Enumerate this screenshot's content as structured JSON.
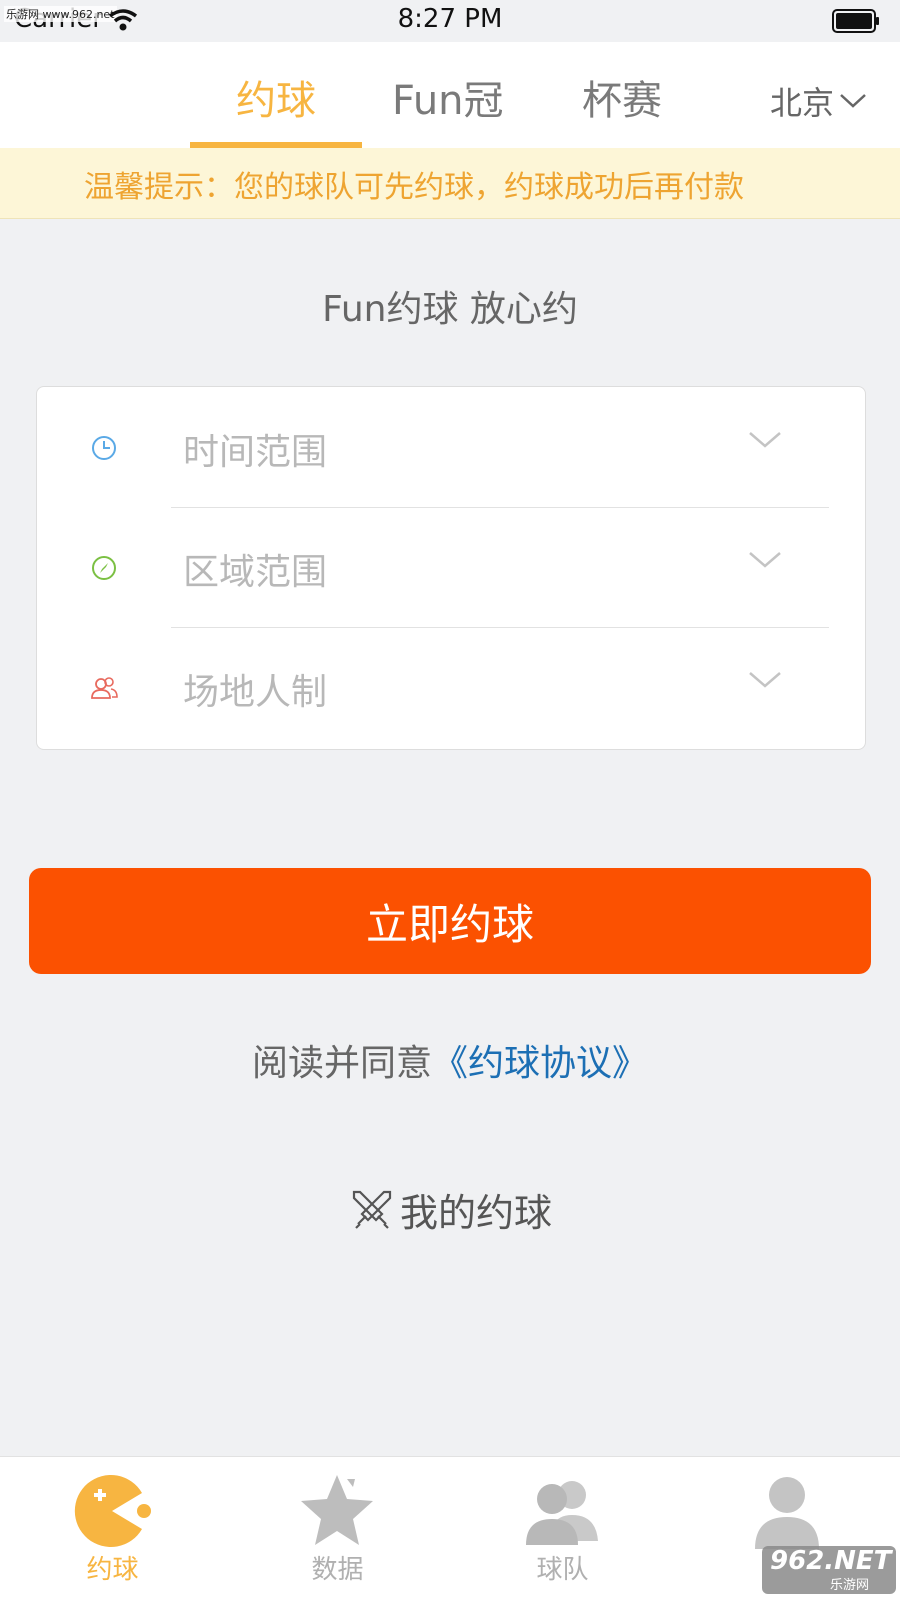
{
  "status_bar": {
    "carrier": "Carrier",
    "time": "8:27 PM",
    "watermark": "乐游网 www.962.net"
  },
  "top_nav": {
    "tabs": [
      {
        "label": "约球"
      },
      {
        "label": "Fun冠"
      },
      {
        "label": "杯赛"
      }
    ],
    "active_tab": "约球",
    "city": "北京"
  },
  "tip": "温馨提示：您的球队可先约球，约球成功后再付款",
  "subtitle": "Fun约球 放心约",
  "selectors": [
    {
      "placeholder": "时间范围",
      "icon": "clock-icon"
    },
    {
      "placeholder": "区域范围",
      "icon": "compass-icon"
    },
    {
      "placeholder": "场地人制",
      "icon": "people-icon"
    }
  ],
  "book_button": "立即约球",
  "agreement": {
    "prefix": "阅读并同意",
    "link": "《约球协议》"
  },
  "my_matches": "我的约球",
  "bottom_tabs": [
    {
      "label": "约球",
      "icon": "pacman-icon"
    },
    {
      "label": "数据",
      "icon": "star-icon"
    },
    {
      "label": "球队",
      "icon": "team-icon"
    },
    {
      "label": "",
      "icon": "profile-icon"
    }
  ],
  "watermark_logo": {
    "big": "962.NET",
    "small": "乐游网"
  },
  "colors": {
    "accent": "#f7b541",
    "button": "#fb5101",
    "link": "#1c6fb4",
    "clock_icon": "#5aa9e6",
    "compass_icon": "#7bc043",
    "people_icon": "#e86a5e",
    "tip_bg": "#fdf6d7"
  }
}
